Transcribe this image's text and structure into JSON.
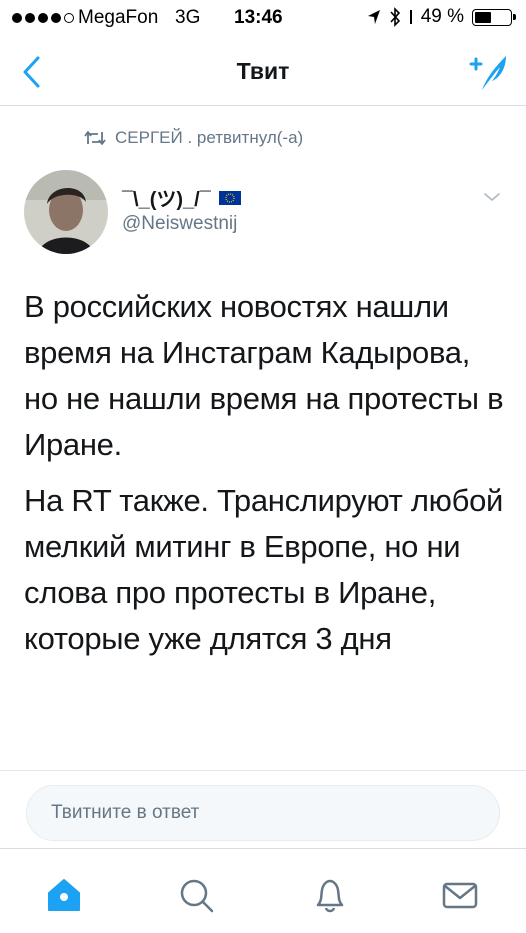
{
  "status_bar": {
    "carrier": "MegaFon",
    "network": "3G",
    "time": "13:46",
    "battery_percent": "49 %",
    "battery_level": 0.49
  },
  "nav": {
    "title": "Твит",
    "back_icon": "chevron-left-icon",
    "compose_icon": "compose-tweet-icon",
    "accent_color": "#1da1f2"
  },
  "retweet": {
    "text": "СЕРГЕЙ . ретвитнул(-а)"
  },
  "author": {
    "name": "¯\\_(ツ)_/¯",
    "handle": "@Neiswestnij"
  },
  "tweet": {
    "paragraphs": [
      "В российских новостях нашли время на Инстаграм Кадырова, но не нашли время на протесты в Иране.",
      "На RT также. Транслируют любой мелкий митинг в Европе, но ни слова про протесты в Иране, которые уже длятся 3 дня"
    ]
  },
  "reply": {
    "placeholder": "Твитните в ответ"
  },
  "tab_bar": {
    "items": [
      "home-icon",
      "search-icon",
      "notifications-icon",
      "messages-icon"
    ]
  }
}
